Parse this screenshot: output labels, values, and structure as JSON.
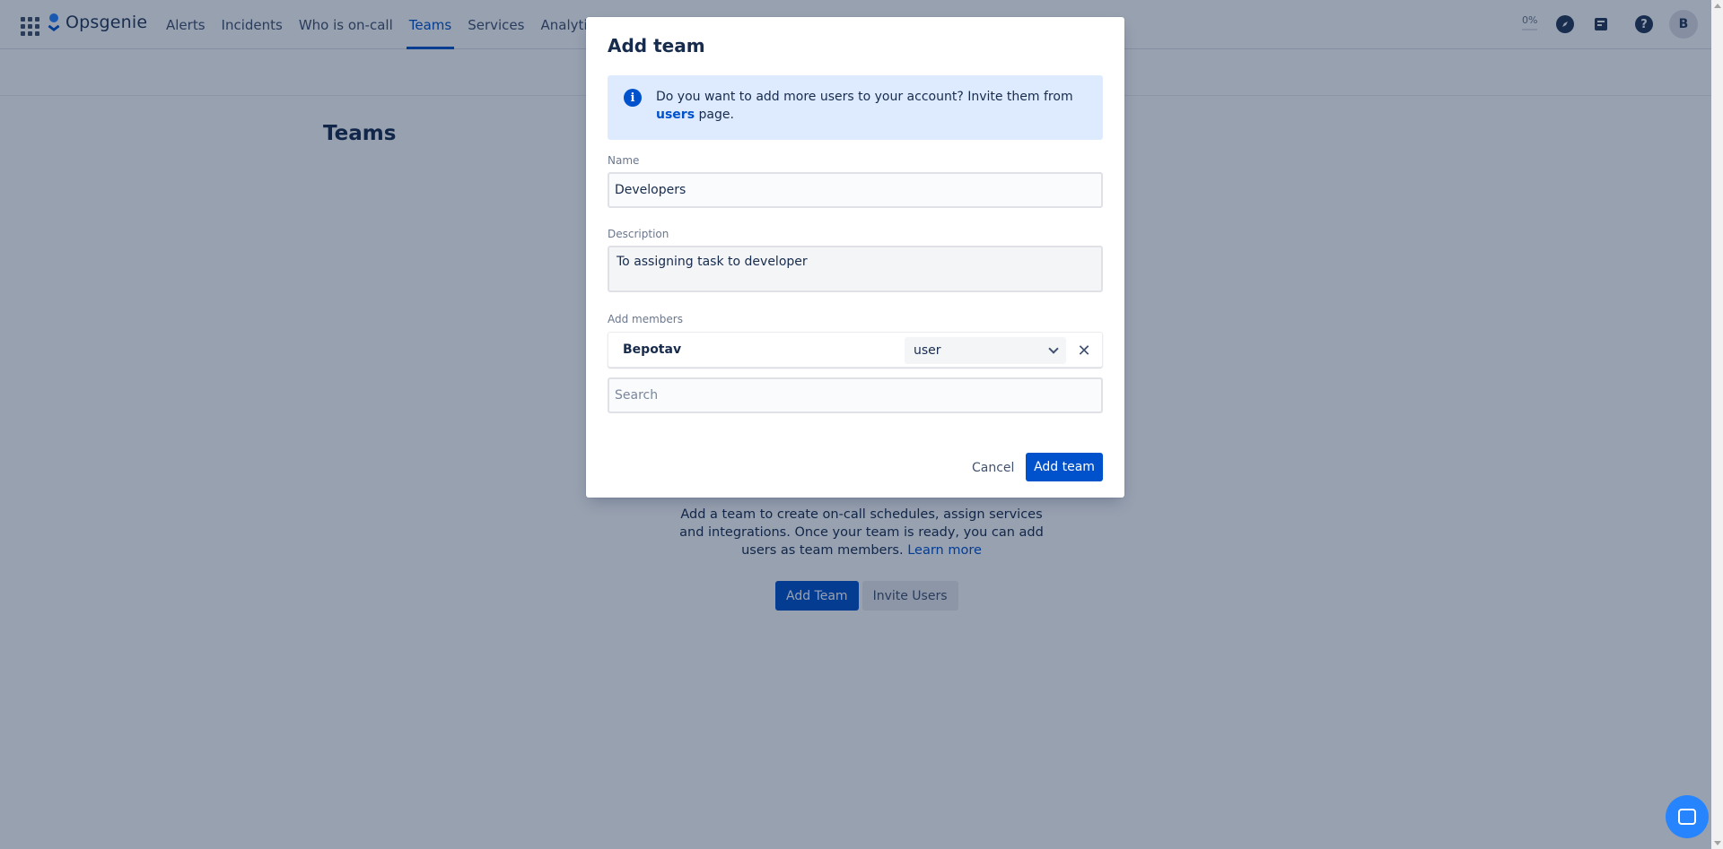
{
  "app": {
    "name": "Opsgenie"
  },
  "nav": {
    "items": [
      {
        "label": "Alerts",
        "active": false
      },
      {
        "label": "Incidents",
        "active": false
      },
      {
        "label": "Who is on-call",
        "active": false
      },
      {
        "label": "Teams",
        "active": true
      },
      {
        "label": "Services",
        "active": false
      },
      {
        "label": "Analytics",
        "active": false
      }
    ],
    "progress": "0%",
    "avatar_initial": "B",
    "help": "?"
  },
  "page": {
    "title": "Teams",
    "empty_text": "Add a team to create on-call schedules, assign services and integrations. Once your team is ready, you can add users as team members.",
    "learn_more": "Learn more",
    "add_team_button": "Add Team",
    "invite_users_button": "Invite Users"
  },
  "modal": {
    "title": "Add team",
    "info": {
      "text_before": "Do you want to add more users to your account? Invite them from",
      "link": "users",
      "text_after": "page."
    },
    "name_label": "Name",
    "name_value": "Developers",
    "description_label": "Description",
    "description_value": "To assigning task to developer",
    "members_label": "Add members",
    "members": [
      {
        "name": "Bepotav",
        "role": "user"
      }
    ],
    "search_placeholder": "Search",
    "cancel_label": "Cancel",
    "submit_label": "Add team"
  },
  "colors": {
    "primary": "#0052cc",
    "info_bg": "#deebff",
    "chat": "#2684ff"
  }
}
